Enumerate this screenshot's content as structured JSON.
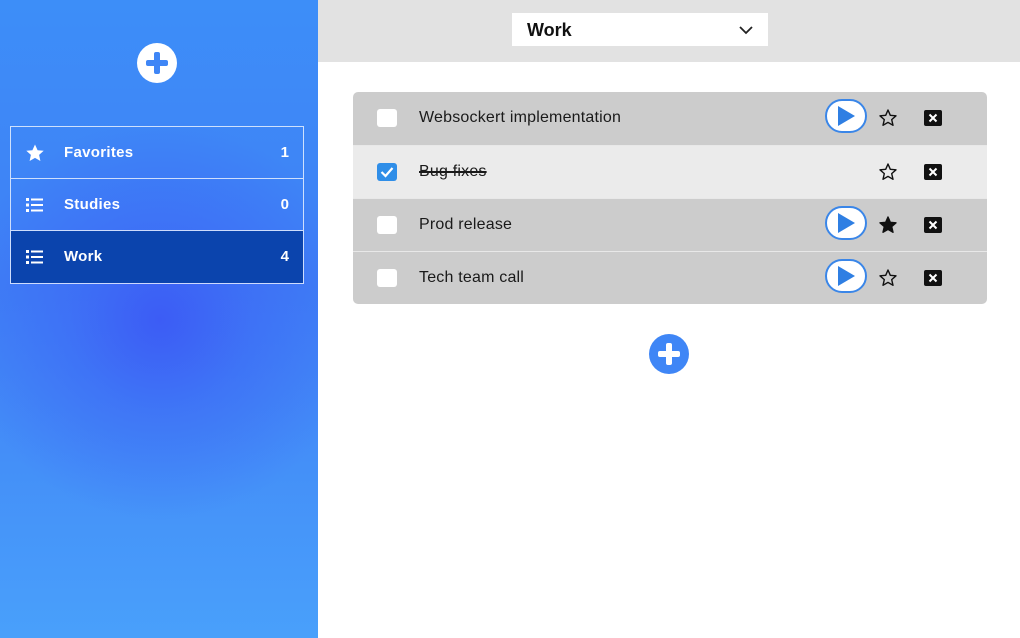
{
  "sidebar": {
    "add_button_icon": "plus-circle-icon",
    "lists": [
      {
        "label": "Favorites",
        "count": "1",
        "icon": "star-icon",
        "active": false
      },
      {
        "label": "Studies",
        "count": "0",
        "icon": "list-icon",
        "active": false
      },
      {
        "label": "Work",
        "count": "4",
        "icon": "list-icon",
        "active": true
      }
    ]
  },
  "header": {
    "selected_list": "Work",
    "dropdown_icon": "chevron-down-icon"
  },
  "tasks": [
    {
      "title": "Websockert implementation",
      "checked": false,
      "starred": false,
      "has_play": true
    },
    {
      "title": "Bug fixes",
      "checked": true,
      "starred": false,
      "has_play": false
    },
    {
      "title": "Prod release",
      "checked": false,
      "starred": true,
      "has_play": true
    },
    {
      "title": "Tech team call",
      "checked": false,
      "starred": false,
      "has_play": true
    }
  ],
  "colors": {
    "accent": "#3f86f6",
    "active_list": "#0b44ad",
    "row_bg": "#cccccc",
    "done_row_bg": "#ebebeb",
    "checkbox_checked": "#2f8ee8"
  }
}
